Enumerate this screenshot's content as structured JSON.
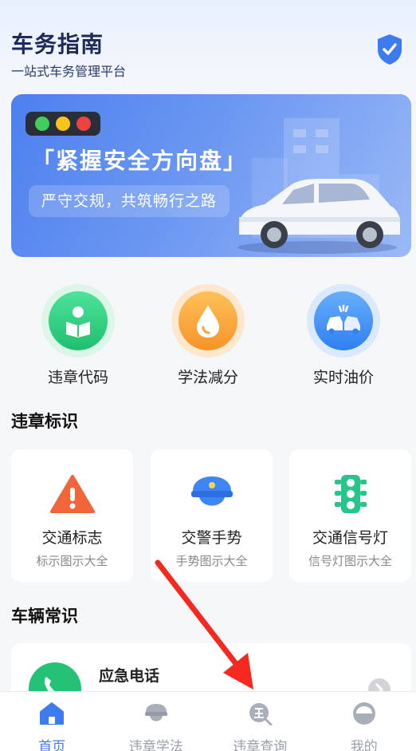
{
  "header": {
    "title": "车务指南",
    "subtitle": "一站式车务管理平台"
  },
  "banner": {
    "title": "「紧握安全方向盘」",
    "subtitle": "严守交规，共筑畅行之路"
  },
  "quick_actions": [
    {
      "label": "违章代码",
      "icon": "reading-person-icon",
      "color": "#2ecf7c"
    },
    {
      "label": "学法减分",
      "icon": "drop-icon",
      "color": "#f59a2b"
    },
    {
      "label": "实时油价",
      "icon": "car-crash-icon",
      "color": "#3d8ef5"
    }
  ],
  "sections": {
    "violation_signs": "违章标识",
    "vehicle_knowledge": "车辆常识"
  },
  "sign_cards": [
    {
      "title": "交通标志",
      "subtitle": "标示图示大全",
      "icon": "warning-triangle-icon"
    },
    {
      "title": "交警手势",
      "subtitle": "手势图示大全",
      "icon": "police-cap-icon"
    },
    {
      "title": "交通信号灯",
      "subtitle": "信号灯图示大全",
      "icon": "traffic-light-icon"
    }
  ],
  "list": {
    "emergency_title": "应急电话"
  },
  "tabbar": [
    {
      "label": "首页",
      "icon": "home-icon",
      "active": true
    },
    {
      "label": "违章学法",
      "icon": "police-cap-icon",
      "active": false
    },
    {
      "label": "违章查询",
      "icon": "violation-search-icon",
      "active": false
    },
    {
      "label": "我的",
      "icon": "profile-icon",
      "active": false
    }
  ],
  "colors": {
    "accent": "#3c7bf0",
    "title": "#1d2a5a"
  }
}
